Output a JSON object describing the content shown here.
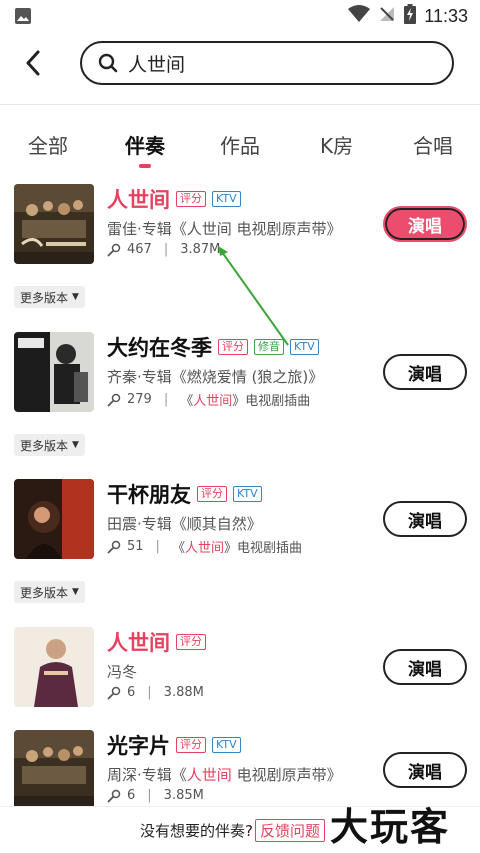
{
  "status": {
    "time": "11:33"
  },
  "search": {
    "query": "人世间"
  },
  "tabs": [
    {
      "label": "全部"
    },
    {
      "label": "伴奏"
    },
    {
      "label": "作品"
    },
    {
      "label": "K房"
    },
    {
      "label": "合唱"
    }
  ],
  "songs": [
    {
      "title": "人世间",
      "tags": [
        "评分",
        "KTV"
      ],
      "subtitle": "雷佳·专辑《人世间 电视剧原声带》",
      "plays": "467",
      "size": "3.87M",
      "action": "演唱"
    },
    {
      "title": "大约在冬季",
      "tags": [
        "评分",
        "修音",
        "KTV"
      ],
      "subtitle": "齐秦·专辑《燃烧爱情 (狼之旅)》",
      "plays": "279",
      "note_pre": "《",
      "note_red": "人世间",
      "note_post": "》电视剧插曲",
      "action": "演唱"
    },
    {
      "title": "干杯朋友",
      "tags": [
        "评分",
        "KTV"
      ],
      "subtitle": "田震·专辑《顺其自然》",
      "plays": "51",
      "note_pre": "《",
      "note_red": "人世间",
      "note_post": "》电视剧插曲",
      "action": "演唱"
    },
    {
      "title": "人世间",
      "tags": [
        "评分"
      ],
      "subtitle": "冯冬",
      "plays": "6",
      "size": "3.88M",
      "action": "演唱"
    },
    {
      "title": "光字片",
      "tags": [
        "评分",
        "KTV"
      ],
      "subtitle_pre": "周深·专辑《",
      "subtitle_red": "人世间",
      "subtitle_post": " 电视剧原声带》",
      "plays": "6",
      "size": "3.85M",
      "action": "演唱"
    }
  ],
  "more_versions": "更多版本",
  "footer": {
    "text": "没有想要的伴奏?",
    "button": "反馈问题"
  },
  "watermark": "大玩客",
  "colors": {
    "accent": "#e5425f",
    "primary_button": "#ec4d6e",
    "ktv": "#2f86c8",
    "fix": "#3aa34b"
  }
}
